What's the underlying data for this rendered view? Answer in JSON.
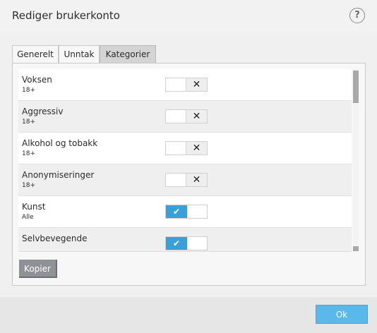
{
  "dialog": {
    "title": "Rediger brukerkonto",
    "help_glyph": "?"
  },
  "tabs": [
    {
      "label": "Generelt",
      "active": false
    },
    {
      "label": "Unntak",
      "active": false
    },
    {
      "label": "Kategorier",
      "active": true
    }
  ],
  "categories": [
    {
      "name": "Voksen",
      "age": "18+",
      "enabled": false,
      "glyph": "✕"
    },
    {
      "name": "Aggressiv",
      "age": "18+",
      "enabled": false,
      "glyph": "✕"
    },
    {
      "name": "Alkohol og tobakk",
      "age": "18+",
      "enabled": false,
      "glyph": "✕"
    },
    {
      "name": "Anonymiseringer",
      "age": "18+",
      "enabled": false,
      "glyph": "✕"
    },
    {
      "name": "Kunst",
      "age": "Alle",
      "enabled": true,
      "glyph": "✔"
    },
    {
      "name": "Selvbevegende",
      "age": "",
      "enabled": true,
      "glyph": "✔"
    }
  ],
  "buttons": {
    "copy": "Kopier",
    "ok": "Ok"
  },
  "colors": {
    "toggle_on": "#3d9fd8",
    "ok_button": "#5bb8ea",
    "copy_button": "#8e9296"
  }
}
